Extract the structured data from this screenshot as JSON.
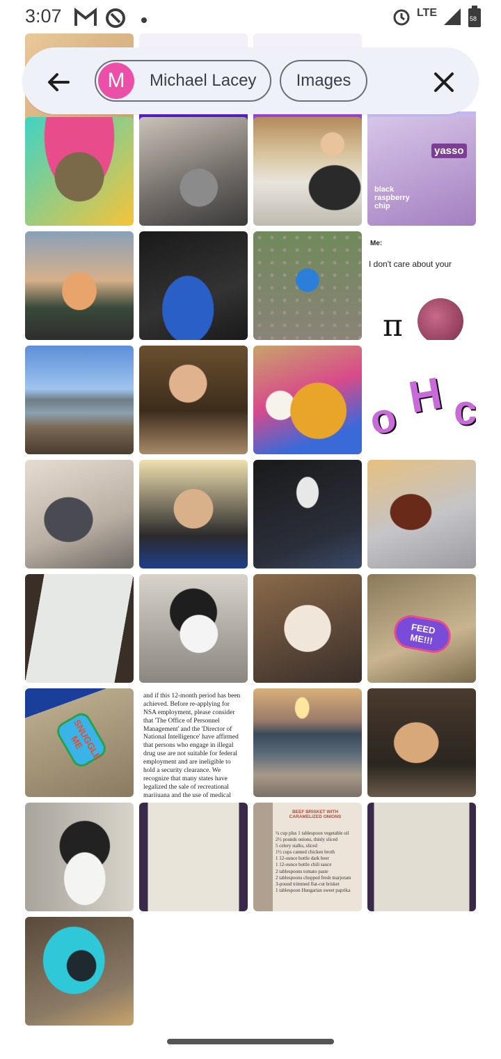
{
  "status_bar": {
    "time": "3:07",
    "network": "LTE",
    "battery": "58"
  },
  "search_filter": {
    "back_icon": "arrow-left-icon",
    "person_chip": {
      "initial": "M",
      "name": "Michael Lacey",
      "avatar_color": "#ec4fa8"
    },
    "type_chip": {
      "label": "Images"
    },
    "close_icon": "close-icon"
  },
  "photos": [
    {
      "name": "photo-cat-sombrero"
    },
    {
      "name": "photo-cart-pot"
    },
    {
      "name": "photo-woman-kitchen"
    },
    {
      "name": "photo-yasso-box",
      "brand": "yasso",
      "flavor": "black raspberry chip"
    },
    {
      "name": "photo-wine-glass"
    },
    {
      "name": "photo-sonic-mask"
    },
    {
      "name": "photo-toddler-stones"
    },
    {
      "name": "photo-meme-onion",
      "line1": "Me:",
      "line2": "I don't care about your"
    },
    {
      "name": "photo-bridge-river"
    },
    {
      "name": "photo-man-eating"
    },
    {
      "name": "photo-omelette-plate"
    },
    {
      "name": "photo-oh-letters"
    },
    {
      "name": "photo-dog-sitting"
    },
    {
      "name": "photo-woman-selfie"
    },
    {
      "name": "photo-black-shirt"
    },
    {
      "name": "photo-tacos-foil"
    },
    {
      "name": "photo-menu"
    },
    {
      "name": "photo-cat-black-white"
    },
    {
      "name": "photo-cat-closeup"
    },
    {
      "name": "photo-feed-me-pin",
      "text": "FEED ME!!!"
    },
    {
      "name": "photo-snuggle-me-pin",
      "text": "SNUGGLE ME"
    },
    {
      "name": "photo-text-document",
      "text": "and if this 12-month period has been achieved. Before re-applying for NSA employment, please consider that 'The Office of Personnel Management' and the 'Director of National Intelligence' have affirmed that persons who engage in illegal drug use are not suitable for federal employment and are ineligible to hold a security clearance. We recognize that many states have legalized the sale of recreational marijuana and the use of medical marijuana. Despite this, the use of marijuana for any purpose remains a violation of federal law."
    },
    {
      "name": "photo-sunset-beach"
    },
    {
      "name": "photo-dog-red-collar"
    },
    {
      "name": "photo-cat-tuxedo"
    },
    {
      "name": "photo-book-page"
    },
    {
      "name": "photo-recipe-page",
      "title": "BEEF BRISKET WITH CARAMELIZED ONIONS",
      "lines": [
        "¼ cup plus 1 tablespoon vegetable oil",
        "2½ pounds onions, thinly sliced",
        "5 celery stalks, sliced",
        "1½ cups canned chicken broth",
        "1 12-ounce bottle dark beer",
        "1 12-ounce bottle chili sauce",
        "2 tablespoons tomato paste",
        "2 tablespoons chopped fresh marjoram",
        "3-pound trimmed flat-cut brisket",
        "1 tablespoon Hungarian sweet paprika"
      ]
    },
    {
      "name": "photo-open-book"
    },
    {
      "name": "photo-cat-bed"
    }
  ]
}
